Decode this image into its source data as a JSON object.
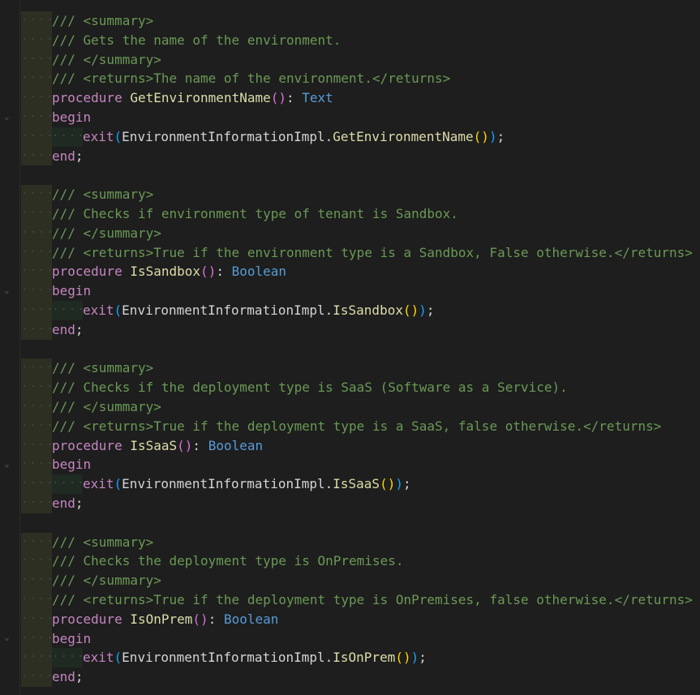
{
  "editor": {
    "blocks": [
      {
        "summary_open": "/// <summary>",
        "summary_text": "/// Gets the name of the environment.",
        "summary_close": "/// </summary>",
        "returns": "/// <returns>The name of the environment.</returns>",
        "kw_procedure": "procedure",
        "proc_name": "GetEnvironmentName",
        "return_type": "Text",
        "kw_begin": "begin",
        "kw_exit": "exit",
        "call_object": "EnvironmentInformationImpl.",
        "call_method": "GetEnvironmentName",
        "kw_end": "end"
      },
      {
        "summary_open": "/// <summary>",
        "summary_text": "/// Checks if environment type of tenant is Sandbox.",
        "summary_close": "/// </summary>",
        "returns": "/// <returns>True if the environment type is a Sandbox, False otherwise.</returns>",
        "kw_procedure": "procedure",
        "proc_name": "IsSandbox",
        "return_type": "Boolean",
        "kw_begin": "begin",
        "kw_exit": "exit",
        "call_object": "EnvironmentInformationImpl.",
        "call_method": "IsSandbox",
        "kw_end": "end"
      },
      {
        "summary_open": "/// <summary>",
        "summary_text": "/// Checks if the deployment type is SaaS (Software as a Service).",
        "summary_close": "/// </summary>",
        "returns": "/// <returns>True if the deployment type is a SaaS, false otherwise.</returns>",
        "kw_procedure": "procedure",
        "proc_name": "IsSaaS",
        "return_type": "Boolean",
        "kw_begin": "begin",
        "kw_exit": "exit",
        "call_object": "EnvironmentInformationImpl.",
        "call_method": "IsSaaS",
        "kw_end": "end"
      },
      {
        "summary_open": "/// <summary>",
        "summary_text": "/// Checks the deployment type is OnPremises.",
        "summary_close": "/// </summary>",
        "returns": "/// <returns>True if the deployment type is OnPremises, false otherwise.</returns>",
        "kw_procedure": "procedure",
        "proc_name": "IsOnPrem",
        "return_type": "Boolean",
        "kw_begin": "begin",
        "kw_exit": "exit",
        "call_object": "EnvironmentInformationImpl.",
        "call_method": "IsOnPrem",
        "kw_end": "end"
      }
    ],
    "punct": {
      "parens_empty_open": "(",
      "parens_empty_close": ")",
      "colon": ": ",
      "semicolon": ";",
      "space": " "
    },
    "whitespace_marks": {
      "level1": "····",
      "level2": "····"
    },
    "fold_icon": "chevron-down-icon",
    "colors": {
      "background": "#1e1e1e",
      "comment": "#6a9955",
      "keyword": "#c586c0",
      "function": "#dcdcaa",
      "type": "#569cd6",
      "bracket_level1": "#da70d6",
      "bracket_level2": "#ffd700",
      "bracket_level3": "#179fff"
    }
  }
}
